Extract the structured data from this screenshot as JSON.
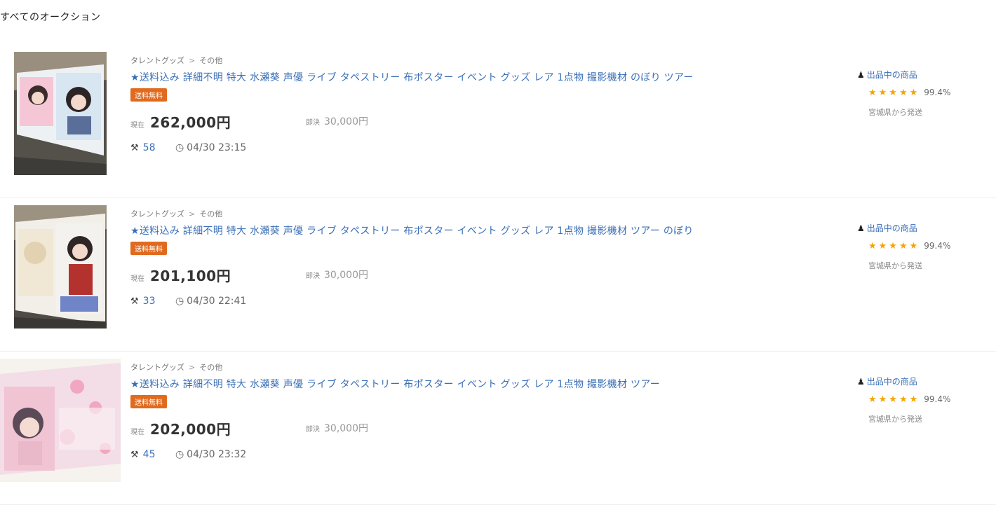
{
  "page": {
    "heading": "すべてのオークション"
  },
  "items": [
    {
      "breadcrumb": [
        "タレントグッズ",
        "その他"
      ],
      "title": "★送料込み 詳細不明 特大 水瀬葵 声優 ライブ タペストリー 布ポスター イベント グッズ レア 1点物 撮影機材 のぼり ツアー",
      "badge": "送料無料",
      "current_label": "現在",
      "current_price": "262,000円",
      "buyout_label": "即決",
      "buyout_price": "30,000円",
      "bids": "58",
      "end_time": "04/30 23:15",
      "seller_label": "出品中の商品",
      "rating": "99.4%",
      "location": "宮城県から発送"
    },
    {
      "breadcrumb": [
        "タレントグッズ",
        "その他"
      ],
      "title": "★送料込み 詳細不明 特大 水瀬葵 声優 ライブ タペストリー 布ポスター イベント グッズ レア 1点物 撮影機材 ツアー のぼり",
      "badge": "送料無料",
      "current_label": "現在",
      "current_price": "201,100円",
      "buyout_label": "即決",
      "buyout_price": "30,000円",
      "bids": "33",
      "end_time": "04/30 22:41",
      "seller_label": "出品中の商品",
      "rating": "99.4%",
      "location": "宮城県から発送"
    },
    {
      "breadcrumb": [
        "タレントグッズ",
        "その他"
      ],
      "title": "★送料込み 詳細不明 特大 水瀬葵 声優 ライブ タペストリー 布ポスター イベント グッズ レア 1点物 撮影機材 ツアー",
      "badge": "送料無料",
      "current_label": "現在",
      "current_price": "202,000円",
      "buyout_label": "即決",
      "buyout_price": "30,000円",
      "bids": "45",
      "end_time": "04/30 23:32",
      "seller_label": "出品中の商品",
      "rating": "99.4%",
      "location": "宮城県から発送"
    }
  ],
  "icons": {
    "bid": "gavel-icon",
    "time": "clock-icon",
    "seller": "person-icon",
    "star": "star-icon"
  },
  "colors": {
    "link": "#3a6fb7",
    "badge": "#e06b1f",
    "star": "#f5a400"
  }
}
